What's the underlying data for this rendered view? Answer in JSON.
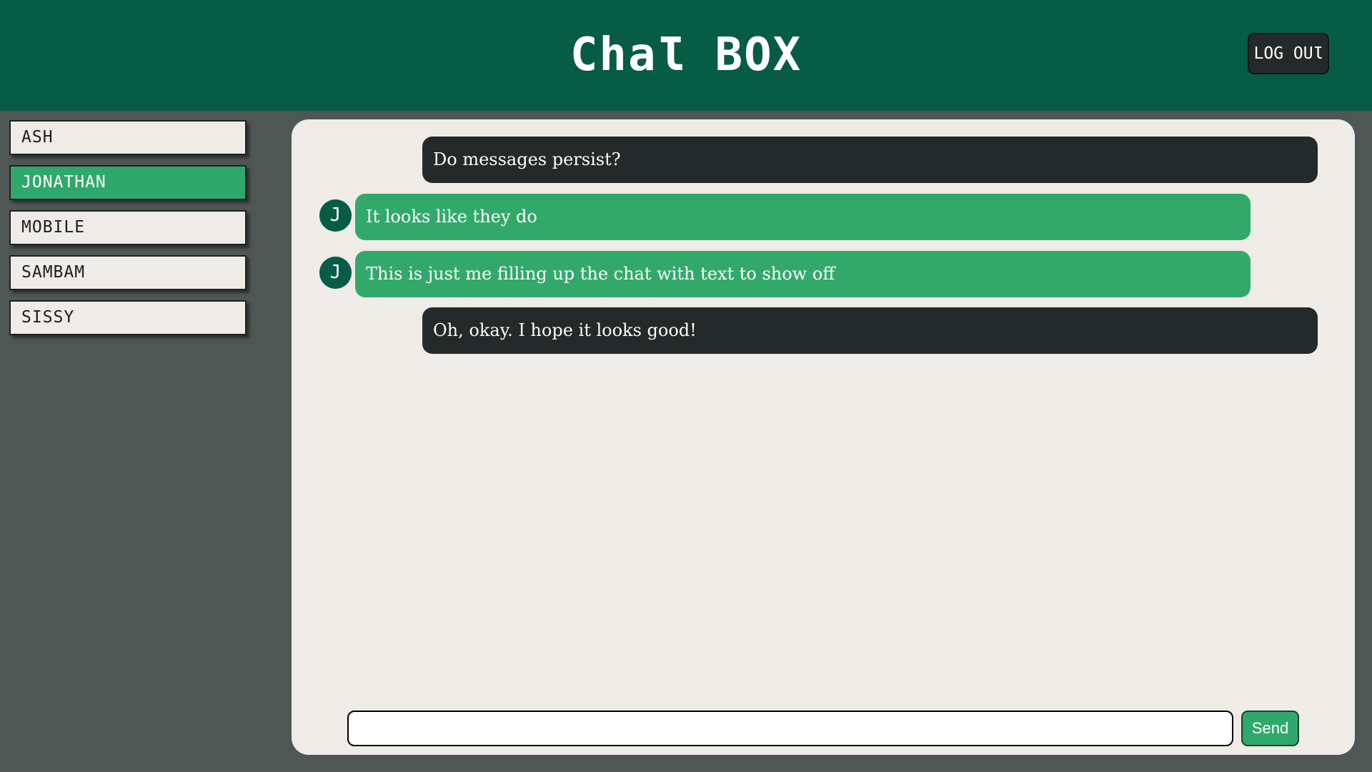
{
  "header": {
    "title": "ChaƖ BOX",
    "logout_label": "LOG OUƖ"
  },
  "sidebar": {
    "items": [
      {
        "label": "ASH",
        "active": false
      },
      {
        "label": "JONATHAN",
        "active": true
      },
      {
        "label": "MOBILE",
        "active": false
      },
      {
        "label": "SAMBAM",
        "active": false
      },
      {
        "label": "SISSY",
        "active": false
      }
    ]
  },
  "chat": {
    "messages": [
      {
        "from": "self",
        "text": "Do messages persist?"
      },
      {
        "from": "other",
        "avatar": "J",
        "text": "It looks like they do"
      },
      {
        "from": "other",
        "avatar": "J",
        "text": "This is just me filling up the chat with text to show off"
      },
      {
        "from": "self",
        "text": "Oh, okay. I hope it looks good!"
      }
    ]
  },
  "composer": {
    "value": "",
    "send_label": "Send"
  },
  "colors": {
    "header_bg": "#075c46",
    "accent_green": "#2fa96b",
    "dark": "#232a29",
    "panel_bg": "#efebe6",
    "page_bg": "#4f5754"
  }
}
